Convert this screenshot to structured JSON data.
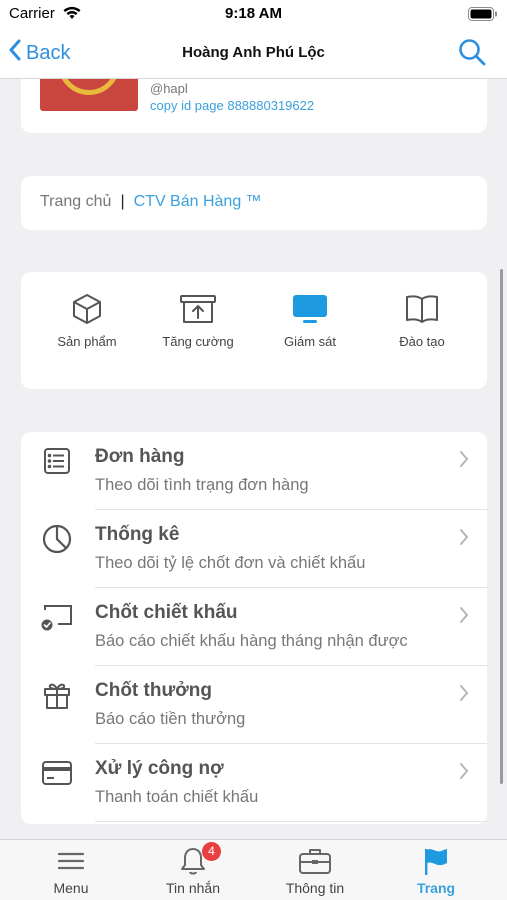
{
  "status_bar": {
    "carrier": "Carrier",
    "time": "9:18 AM"
  },
  "nav": {
    "back_label": "Back",
    "title": "Hoàng Anh Phú Lộc"
  },
  "profile": {
    "handle": "@hapl",
    "copy_id": "copy id page 888880319622"
  },
  "breadcrumb": {
    "home": "Trang chủ",
    "separator": "|",
    "current": "CTV Bán Hàng ™"
  },
  "tabs": [
    {
      "label": "Sản phẩm",
      "icon": "box-icon"
    },
    {
      "label": "Tăng cường",
      "icon": "upload-box-icon"
    },
    {
      "label": "Giám sát",
      "icon": "monitor-icon"
    },
    {
      "label": "Đào tạo",
      "icon": "book-icon"
    }
  ],
  "menu": [
    {
      "title": "Đơn hàng",
      "subtitle": "Theo dõi tình trạng đơn hàng",
      "icon": "list-icon"
    },
    {
      "title": "Thống kê",
      "subtitle": "Theo dõi tỷ lệ chốt đơn và chiết khấu",
      "icon": "pie-chart-icon"
    },
    {
      "title": "Chốt chiết khấu",
      "subtitle": "Báo cáo chiết khấu hàng tháng nhận được",
      "icon": "cast-check-icon"
    },
    {
      "title": "Chốt thưởng",
      "subtitle": "Báo cáo tiền thưởng",
      "icon": "gift-icon"
    },
    {
      "title": "Xử lý công nợ",
      "subtitle": "Thanh toán chiết khấu",
      "icon": "credit-card-icon"
    }
  ],
  "tab_bar": [
    {
      "label": "Menu",
      "icon": "hamburger-icon"
    },
    {
      "label": "Tin nhắn",
      "icon": "bell-icon",
      "badge": "4"
    },
    {
      "label": "Thông tin",
      "icon": "briefcase-icon"
    },
    {
      "label": "Trang",
      "icon": "flag-icon",
      "active": true
    }
  ],
  "colors": {
    "accent": "#3aa0de",
    "back_blue": "#2d8fe0",
    "badge_red": "#e84040",
    "background": "#f0f0f3"
  }
}
